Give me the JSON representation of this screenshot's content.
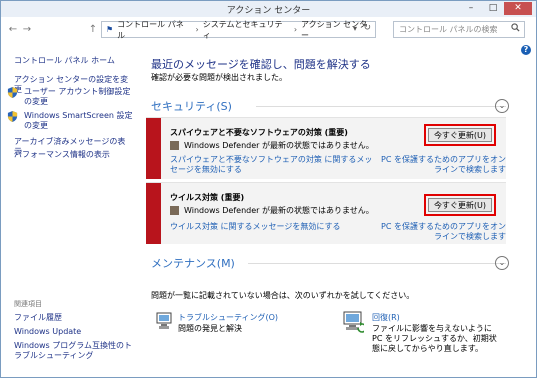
{
  "window": {
    "title": "アクション センター",
    "minimize": "–",
    "maximize": "□",
    "close": "✕"
  },
  "nav": {
    "back": "←",
    "forward": "→",
    "up": "↑"
  },
  "address": {
    "breadcrumb": [
      "コントロール パネル",
      "システムとセキュリティ",
      "アクション センター"
    ],
    "separator": "›",
    "dropdown": "▾",
    "refresh": "↻"
  },
  "search": {
    "placeholder": "コントロール パネルの検索",
    "icon": "🔍"
  },
  "help": "?",
  "sidebar": {
    "home": "コントロール パネル ホーム",
    "links": [
      "アクション センターの設定を変更",
      "ユーザー アカウント制御設定の変更",
      "Windows SmartScreen 設定の変更",
      "アーカイブ済みメッセージの表示",
      "パフォーマンス情報の表示"
    ],
    "related_heading": "関連項目",
    "related": [
      "ファイル履歴",
      "Windows Update",
      "Windows プログラム互換性のトラブルシューティング"
    ]
  },
  "main": {
    "heading": "最近のメッセージを確認し、問題を解決する",
    "subheading": "確認が必要な問題が検出されました。",
    "security": {
      "label": "セキュリティ(S)",
      "chevron": "⌄",
      "cards": [
        {
          "title": "スパイウェアと不要なソフトウェアの対策 (重要)",
          "description": "Windows Defender が最新の状態ではありません。",
          "button": "今すぐ更新(U)",
          "link_left": "スパイウェアと不要なソフトウェアの対策 に関するメッセージを無効にする",
          "link_right": "PC を保護するためのアプリをオンラインで検索します"
        },
        {
          "title": "ウイルス対策 (重要)",
          "description": "Windows Defender が最新の状態ではありません。",
          "button": "今すぐ更新(U)",
          "link_left": "ウイルス対策 に関するメッセージを無効にする",
          "link_right": "PC を保護するためのアプリをオンラインで検索します"
        }
      ]
    },
    "maintenance": {
      "label": "メンテナンス(M)",
      "chevron": "⌄"
    },
    "no_problem_text": "問題が一覧に記載されていない場合は、次のいずれかを試してください。",
    "tools": [
      {
        "name": "トラブルシューティング(O)",
        "description": "問題の発見と解決",
        "icon": "troubleshoot-icon"
      },
      {
        "name": "回復(R)",
        "description": "ファイルに影響を与えないように PC をリフレッシュするか、初期状態に戻してからやり直します。",
        "icon": "recovery-icon"
      }
    ]
  },
  "colors": {
    "link": "#1e3287",
    "section_heading": "#2f6fc0",
    "critical": "#b8141c",
    "highlight_border": "#e00000"
  }
}
